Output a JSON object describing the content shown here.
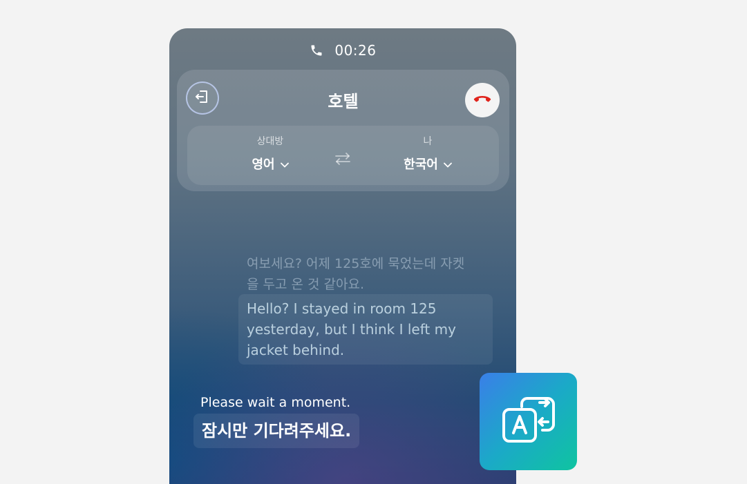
{
  "call": {
    "timer": "00:26"
  },
  "header": {
    "title": "호텔"
  },
  "languages": {
    "other_caption": "상대방",
    "other_lang": "영어",
    "me_caption": "나",
    "me_lang": "한국어"
  },
  "messages": {
    "incoming_original": "여보세요? 어제 125호에 묵었는데 자켓을 두고 온 것 같아요.",
    "incoming_translation": "Hello? I stayed in room 125 yesterday, but I think I left my jacket behind.",
    "outgoing_translation": "Please wait a moment.",
    "outgoing_original": "잠시만 기다려주세요."
  },
  "icons": {
    "status": "phone-icon",
    "back": "exit-door-icon",
    "end_call": "hang-up-icon",
    "swap": "swap-arrows-icon",
    "app": "translate-app-icon"
  },
  "colors": {
    "end_call": "#e0241c",
    "app_icon_start": "#3a7fe8",
    "app_icon_end": "#0fc4a0"
  }
}
